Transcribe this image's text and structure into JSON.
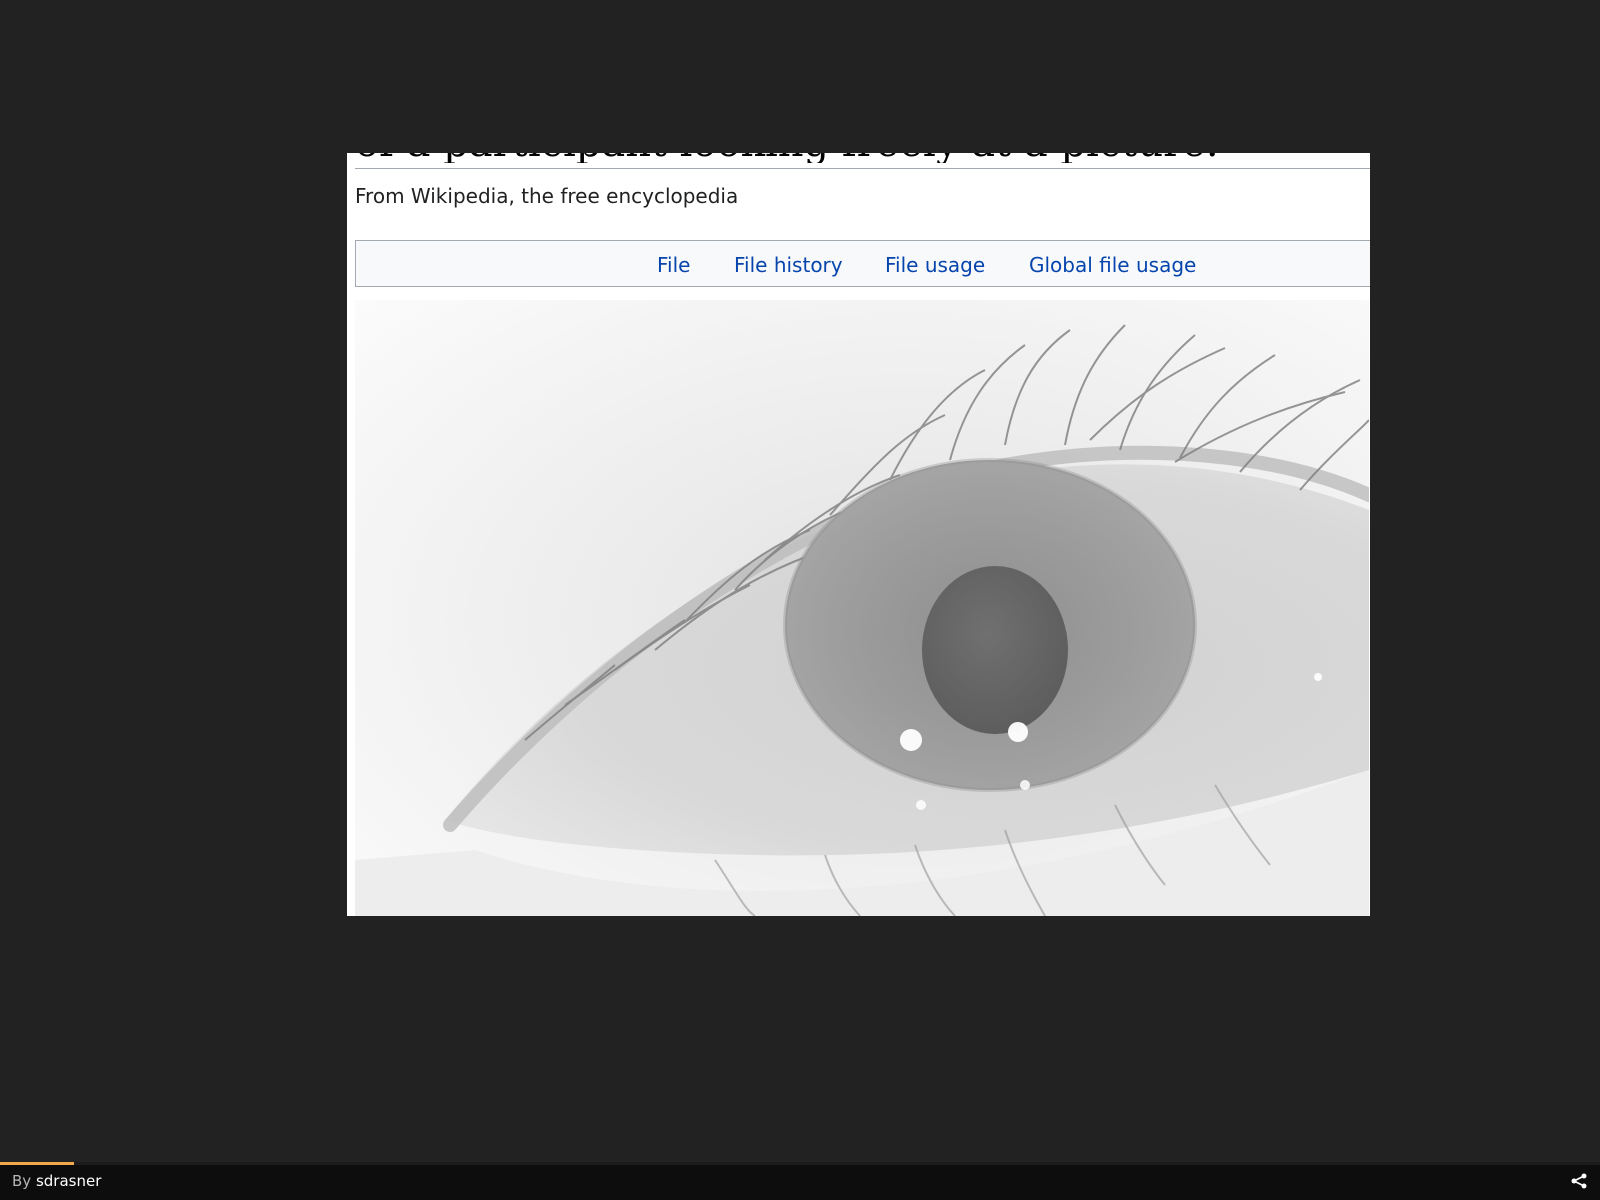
{
  "wiki_page": {
    "title_fragment": "of a participant looking freely at a picture.",
    "tagline": "From Wikipedia, the free encyclopedia",
    "file_tabs": [
      {
        "label": "File",
        "active": true
      },
      {
        "label": "File history",
        "active": false
      },
      {
        "label": "File usage",
        "active": false
      },
      {
        "label": "Global file usage",
        "active": false
      }
    ],
    "media_subject": "close-up grayscale eye"
  },
  "colors": {
    "background": "#222222",
    "page": "#ffffff",
    "link": "#0645ad",
    "active_link": "#0b0080",
    "tab_bar": "#f8f9fa",
    "progress_accent": "#f2a94b"
  },
  "footer": {
    "byline_prefix": "By",
    "author": "sdrasner",
    "share_icon": "share-icon",
    "progress_fraction": 0.046
  }
}
